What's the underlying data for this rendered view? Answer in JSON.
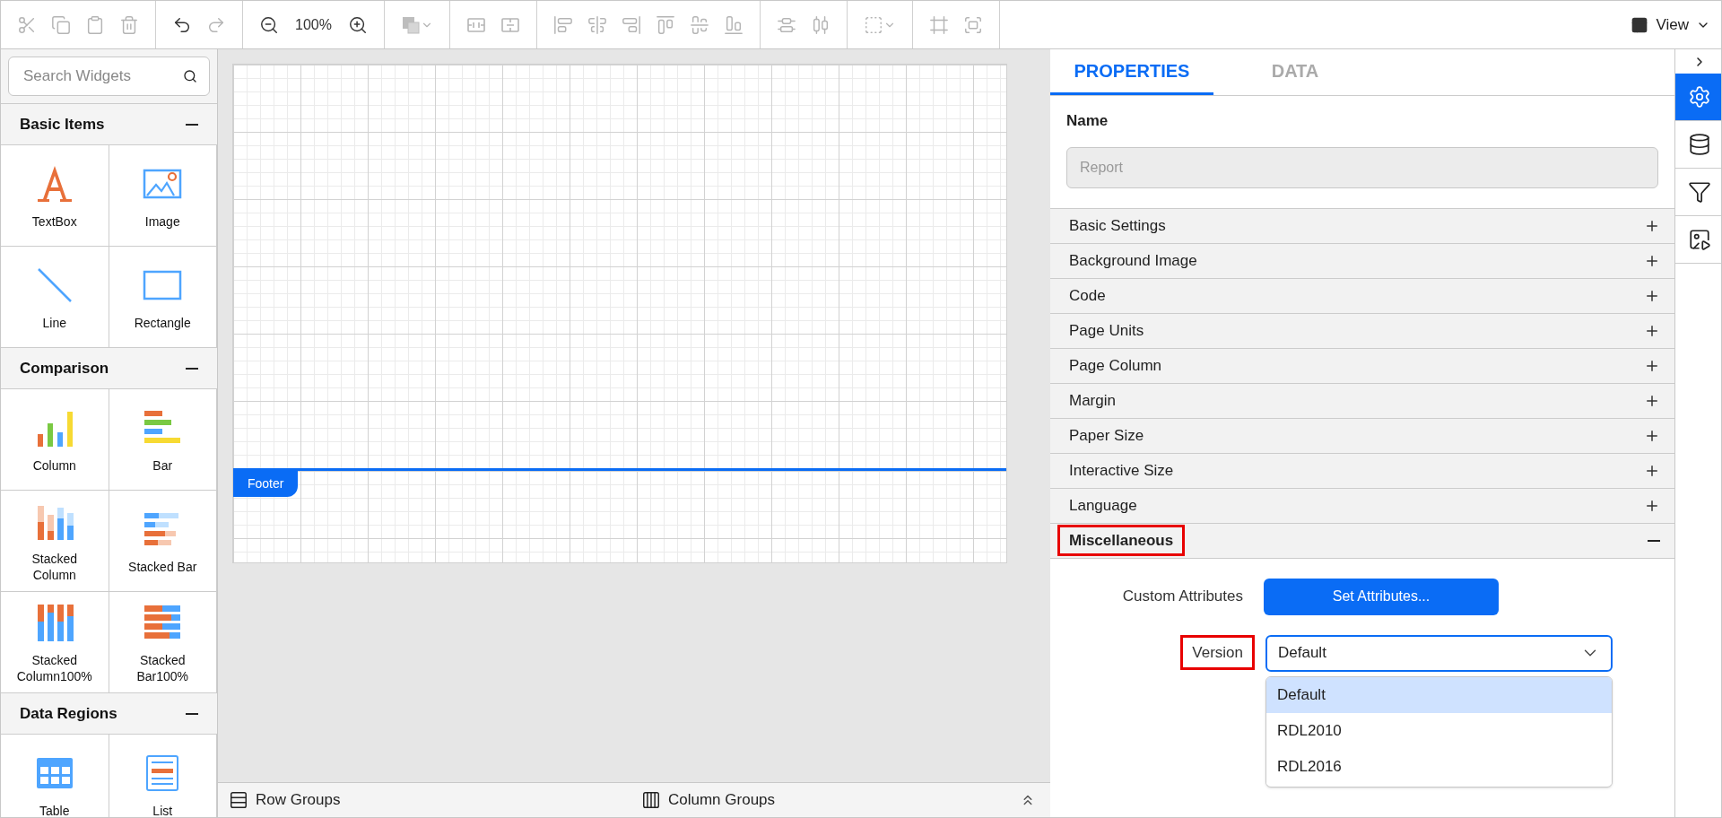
{
  "toolbar": {
    "groups": [
      [
        {
          "kind": "icon",
          "disabled": true
        },
        {
          "kind": "icon",
          "disabled": true
        },
        {
          "kind": "icon",
          "disabled": true
        },
        {
          "kind": "icon",
          "disabled": true
        }
      ],
      [
        {
          "kind": "icon",
          "disabled": false
        },
        {
          "kind": "icon",
          "disabled": true
        }
      ],
      [
        {
          "kind": "icon",
          "disabled": false
        },
        {
          "kind": "text",
          "text": "100%"
        },
        {
          "kind": "icon",
          "disabled": false
        }
      ],
      [
        {
          "kind": "menu",
          "disabled": true
        }
      ],
      [
        {
          "kind": "icon",
          "disabled": true
        },
        {
          "kind": "icon",
          "disabled": true
        }
      ],
      [
        {
          "kind": "icon",
          "disabled": true
        },
        {
          "kind": "icon",
          "disabled": true
        },
        {
          "kind": "icon",
          "disabled": true
        },
        {
          "kind": "icon",
          "disabled": true
        },
        {
          "kind": "icon",
          "disabled": true
        },
        {
          "kind": "icon",
          "disabled": true
        }
      ],
      [
        {
          "kind": "icon",
          "disabled": true
        },
        {
          "kind": "icon",
          "disabled": true
        }
      ],
      [
        {
          "kind": "menu",
          "disabled": true
        }
      ],
      [
        {
          "kind": "icon",
          "disabled": true
        },
        {
          "kind": "icon",
          "disabled": true
        }
      ]
    ],
    "view": {
      "label": "View"
    }
  },
  "widgets": {
    "search": {
      "placeholder": "Search Widgets"
    },
    "sections": [
      {
        "title": "Basic Items",
        "expanded": true,
        "items": [
          {
            "label": "TextBox",
            "kind": "textbox"
          },
          {
            "label": "Image",
            "kind": "image"
          },
          {
            "label": "Line",
            "kind": "line"
          },
          {
            "label": "Rectangle",
            "kind": "rectangle"
          }
        ]
      },
      {
        "title": "Comparison",
        "expanded": true,
        "items": [
          {
            "label": "Column",
            "kind": "column"
          },
          {
            "label": "Bar",
            "kind": "bar"
          },
          {
            "label": "Stacked Column",
            "kind": "stacked-column"
          },
          {
            "label": "Stacked Bar",
            "kind": "stacked-bar"
          },
          {
            "label": "Stacked Column100%",
            "kind": "stacked-column-100"
          },
          {
            "label": "Stacked Bar100%",
            "kind": "stacked-bar-100"
          }
        ]
      },
      {
        "title": "Data Regions",
        "expanded": true,
        "items": [
          {
            "label": "Table",
            "kind": "table"
          },
          {
            "label": "List",
            "kind": "list"
          }
        ]
      }
    ]
  },
  "canvas": {
    "footer": {
      "label": "Footer"
    }
  },
  "group_bar": {
    "items": [
      {
        "label": "Row Groups"
      },
      {
        "label": "Column Groups"
      }
    ]
  },
  "properties": {
    "tabs": [
      {
        "label": "PROPERTIES",
        "selected": true
      },
      {
        "label": "DATA",
        "selected": false
      }
    ],
    "name": {
      "label": "Name",
      "value": "Report",
      "disabled": true
    },
    "sections": [
      {
        "label": "Basic Settings",
        "expanded": false,
        "highlighted": false
      },
      {
        "label": "Background Image",
        "expanded": false,
        "highlighted": false
      },
      {
        "label": "Code",
        "expanded": false,
        "highlighted": false
      },
      {
        "label": "Page Units",
        "expanded": false,
        "highlighted": false
      },
      {
        "label": "Page Column",
        "expanded": false,
        "highlighted": false
      },
      {
        "label": "Margin",
        "expanded": false,
        "highlighted": false
      },
      {
        "label": "Paper Size",
        "expanded": false,
        "highlighted": false
      },
      {
        "label": "Interactive Size",
        "expanded": false,
        "highlighted": false
      },
      {
        "label": "Language",
        "expanded": false,
        "highlighted": false
      },
      {
        "label": "Miscellaneous",
        "expanded": true,
        "highlighted": true,
        "fields": [
          {
            "kind": "button",
            "label": "Custom Attributes",
            "highlighted": false,
            "button": "Set Attributes..."
          },
          {
            "kind": "select",
            "label": "Version",
            "highlighted": true,
            "value": "Default",
            "open": true,
            "options": [
              {
                "label": "Default",
                "selected": true
              },
              {
                "label": "RDL2010",
                "selected": false
              },
              {
                "label": "RDL2016",
                "selected": false
              }
            ]
          }
        ]
      }
    ]
  },
  "side_tabs": [
    {
      "selected": true
    },
    {
      "selected": false
    },
    {
      "selected": false
    },
    {
      "selected": false
    }
  ]
}
